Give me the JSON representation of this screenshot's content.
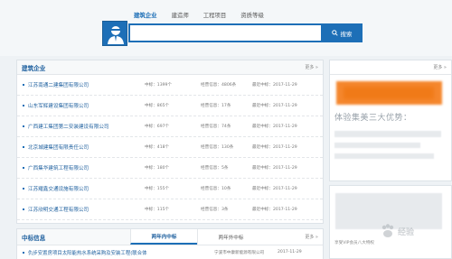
{
  "search": {
    "tabs": [
      {
        "label": "建筑企业",
        "active": true
      },
      {
        "label": "建造师",
        "active": false
      },
      {
        "label": "工程项目",
        "active": false
      },
      {
        "label": "资质等级",
        "active": false
      }
    ],
    "placeholder": "",
    "button_label": "搜索"
  },
  "companies": {
    "title": "建筑企业",
    "more": "更多 »",
    "rows": [
      {
        "name": "江苏南通二建集团有限公司",
        "wins": "中标：1399个",
        "biz": "经营信息：4806条",
        "recent": "最近中标：2017-11-29"
      },
      {
        "name": "山东军辉建设集团有限公司",
        "wins": "中标：865个",
        "biz": "经营信息：17条",
        "recent": "最近中标：2017-11-29"
      },
      {
        "name": "广西建工集团第二安装建设有限公司",
        "wins": "中标：697个",
        "biz": "经营信息：74条",
        "recent": "最近中标：2017-11-29"
      },
      {
        "name": "北京城建集团有限责任公司",
        "wins": "中标：418个",
        "biz": "经营信息：130条",
        "recent": "最近中标：2017-11-29"
      },
      {
        "name": "广西集华建筑工程有限公司",
        "wins": "中标：180个",
        "biz": "经营信息：5条",
        "recent": "最近中标：2017-11-29"
      },
      {
        "name": "江苏耀鑫交通设施有限公司",
        "wins": "中标：155个",
        "biz": "经营信息：10条",
        "recent": "最近中标：2017-11-29"
      },
      {
        "name": "江苏欣明交通工程有限公司",
        "wins": "中标：115个",
        "biz": "经营信息：3条",
        "recent": "最近中标：2017-11-29"
      }
    ]
  },
  "bids": {
    "title": "中标信息",
    "tabs": [
      {
        "label": "两年内中标",
        "active": true
      },
      {
        "label": "两年外中标",
        "active": false
      }
    ],
    "more": "更多 »",
    "rows": [
      {
        "title": "仇步安置房项目太阳能热水系统采购及安装工程(联合体",
        "company": "宁波市中康新能源有限公司",
        "date": "2017-11-29"
      }
    ]
  },
  "sidebar": {
    "promo_text": "体验集美三大优势：",
    "promo_small": "享受VIP会员八大特权"
  },
  "watermark": {
    "text": "经验"
  },
  "colors": {
    "primary": "#1d6fb7",
    "accent_orange": "#f5872d"
  }
}
